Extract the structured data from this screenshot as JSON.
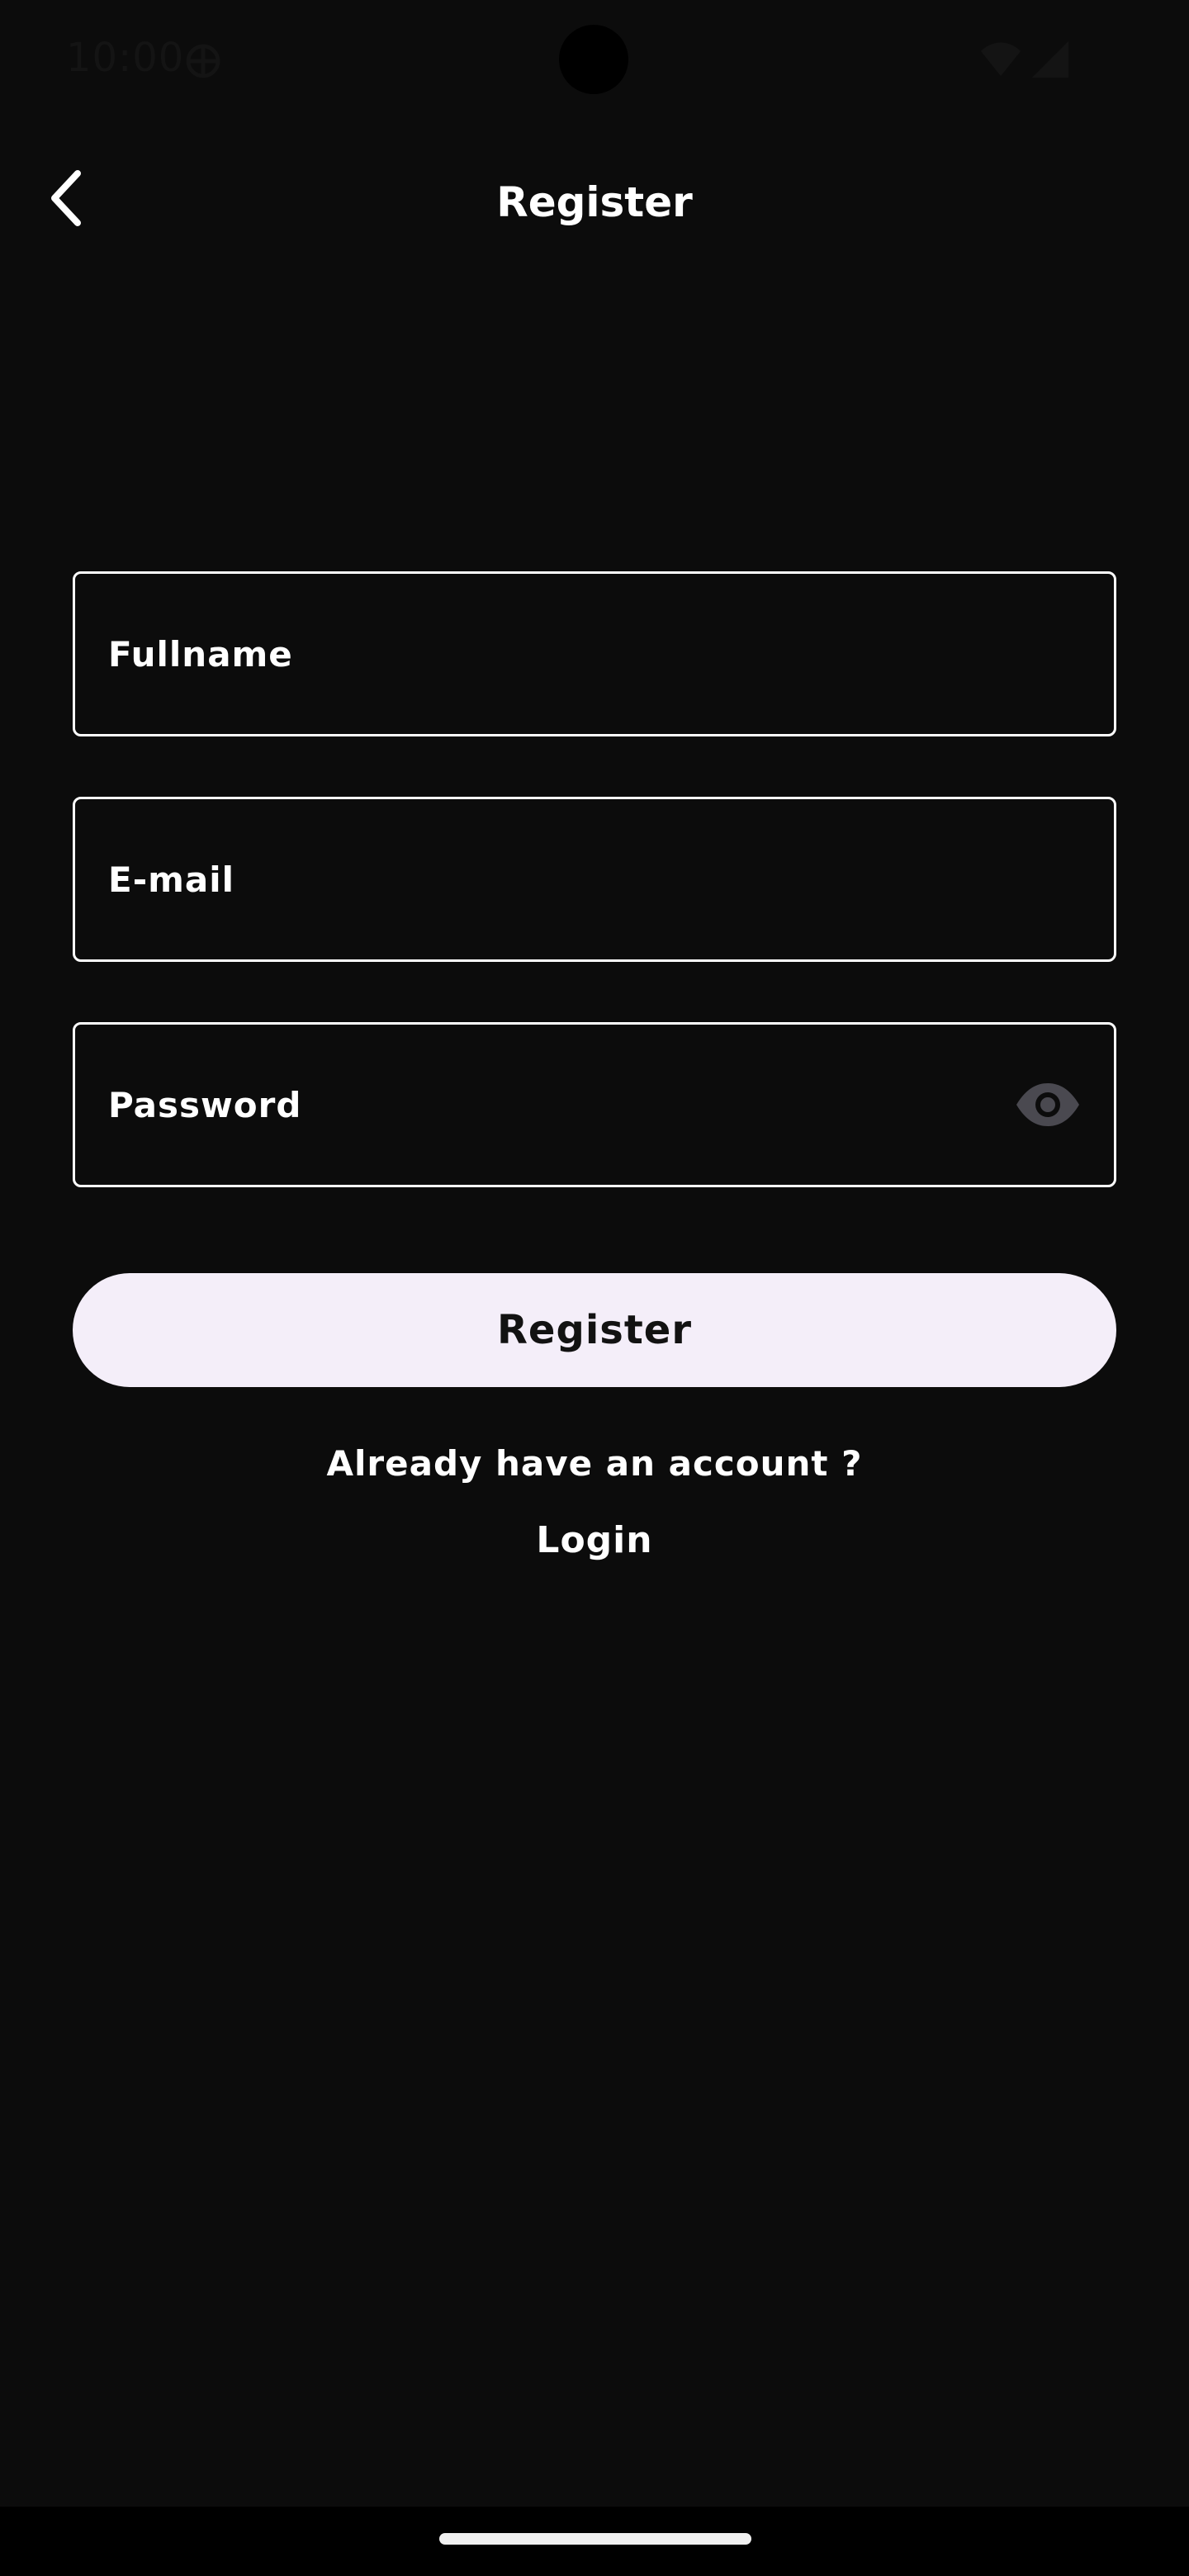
{
  "status_bar": {
    "time": "10:00",
    "icons": [
      "sync-icon",
      "wifi-icon",
      "signal-icon"
    ]
  },
  "header": {
    "back_icon": "chevron-left-icon",
    "title": "Register"
  },
  "form": {
    "fullname": {
      "placeholder": "Fullname",
      "value": ""
    },
    "email": {
      "placeholder": "E-mail",
      "value": ""
    },
    "password": {
      "placeholder": "Password",
      "value": "",
      "toggle_icon": "eye-icon"
    },
    "submit_label": "Register"
  },
  "footer": {
    "already_text": "Already have an account ?",
    "login_label": "Login"
  },
  "colors": {
    "background": "#0c0c0c",
    "button_bg": "#f4eef9",
    "button_text": "#121212",
    "border": "#ffffff",
    "eye_icon": "#4a4950"
  }
}
